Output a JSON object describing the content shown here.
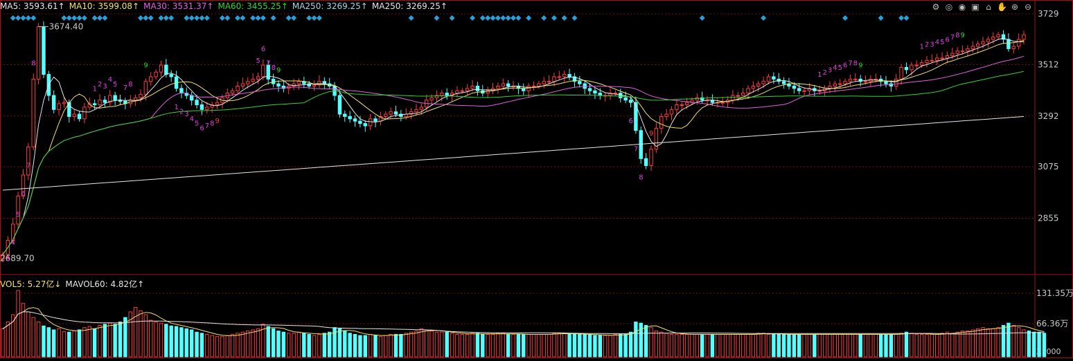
{
  "legend_main": [
    {
      "label": "MA5: 3593.61",
      "arrow": "↑",
      "color": "#e6e6e6"
    },
    {
      "label": "MA10: 3599.08",
      "arrow": "↑",
      "color": "#f2e26b"
    },
    {
      "label": "MA30: 3531.37",
      "arrow": "↑",
      "color": "#e25fe2"
    },
    {
      "label": "MA60: 3455.25",
      "arrow": "↑",
      "color": "#33d633"
    },
    {
      "label": "MA250: 3269.25",
      "arrow": "↑",
      "color": "#9ed8e8"
    },
    {
      "label": "MA250: 3269.25",
      "arrow": "↑",
      "color": "#e6e6e6"
    }
  ],
  "legend_volume": [
    {
      "label": "VOL5: 5.27亿",
      "arrow": "↓",
      "color": "#f2e26b"
    },
    {
      "label": "MAVOL60: 4.82亿",
      "arrow": "↑",
      "color": "#e6e6e6"
    }
  ],
  "toolbar_icons": [
    "settings-icon",
    "view-icon",
    "eye-icon",
    "bag-icon",
    "lock-icon",
    "hand-icon",
    "zoom-in-icon",
    "zoom-out-icon"
  ],
  "chart_data": {
    "type": "candlestick",
    "price_axis": {
      "ticks": [
        "3729",
        "3512",
        "3292",
        "3075",
        "2855"
      ],
      "ylim": [
        2620,
        3729
      ]
    },
    "volume_axis": {
      "ticks": [
        "131.35万",
        "66.36万"
      ],
      "unit_label": "X1000"
    },
    "annotations": {
      "high": "3674.40",
      "low": "2689.70"
    },
    "colors": {
      "up": "#ff3c3c",
      "down": "#54ffff",
      "ma5": "#e6e6e6",
      "ma10": "#f2e26b",
      "ma30": "#e25fe2",
      "ma60": "#33d633",
      "ma250": "#e6e6e6",
      "seq": "#e040e0",
      "nine": "#22dd22",
      "nine_low": "#ff4040",
      "diamond": "#2aa0d8",
      "grid": "#7a1010",
      "frame": "#a01010"
    },
    "closes": [
      2700,
      2760,
      2830,
      2950,
      3040,
      3160,
      3450,
      3674,
      3470,
      3380,
      3320,
      3345,
      3350,
      3290,
      3300,
      3280,
      3330,
      3345,
      3340,
      3360,
      3350,
      3380,
      3360,
      3355,
      3345,
      3360,
      3370,
      3385,
      3440,
      3460,
      3480,
      3510,
      3470,
      3460,
      3410,
      3390,
      3380,
      3360,
      3340,
      3320,
      3330,
      3340,
      3350,
      3370,
      3390,
      3400,
      3420,
      3430,
      3440,
      3450,
      3460,
      3510,
      3450,
      3430,
      3420,
      3410,
      3420,
      3430,
      3440,
      3430,
      3420,
      3425,
      3440,
      3430,
      3420,
      3380,
      3300,
      3290,
      3280,
      3270,
      3260,
      3250,
      3280,
      3270,
      3290,
      3300,
      3310,
      3300,
      3290,
      3300,
      3310,
      3320,
      3330,
      3360,
      3370,
      3380,
      3390,
      3380,
      3390,
      3400,
      3400,
      3410,
      3420,
      3400,
      3390,
      3400,
      3410,
      3420,
      3430,
      3420,
      3420,
      3410,
      3400,
      3420,
      3420,
      3430,
      3440,
      3440,
      3460,
      3460,
      3470,
      3460,
      3440,
      3430,
      3410,
      3400,
      3390,
      3380,
      3380,
      3390,
      3390,
      3370,
      3360,
      3350,
      3230,
      3110,
      3080,
      3150,
      3240,
      3290,
      3300,
      3320,
      3340,
      3340,
      3350,
      3360,
      3370,
      3360,
      3360,
      3350,
      3350,
      3350,
      3360,
      3380,
      3380,
      3390,
      3410,
      3420,
      3430,
      3440,
      3460,
      3450,
      3440,
      3430,
      3420,
      3410,
      3400,
      3400,
      3410,
      3400,
      3400,
      3410,
      3420,
      3430,
      3430,
      3440,
      3450,
      3450,
      3440,
      3440,
      3450,
      3450,
      3440,
      3430,
      3420,
      3450,
      3500,
      3490,
      3510,
      3510,
      3520,
      3530,
      3530,
      3540,
      3540,
      3550,
      3560,
      3570,
      3570,
      3580,
      3590,
      3600,
      3610,
      3620,
      3630,
      3640,
      3620,
      3580,
      3590,
      3620,
      3640
    ],
    "volumes": [
      50,
      62,
      75,
      118,
      95,
      80,
      70,
      62,
      55,
      52,
      48,
      50,
      45,
      44,
      46,
      48,
      52,
      54,
      50,
      56,
      58,
      60,
      58,
      62,
      70,
      80,
      88,
      82,
      75,
      65,
      62,
      60,
      58,
      55,
      54,
      52,
      50,
      48,
      44,
      42,
      40,
      38,
      36,
      36,
      38,
      40,
      42,
      44,
      46,
      48,
      50,
      58,
      54,
      50,
      46,
      44,
      42,
      42,
      44,
      42,
      40,
      38,
      40,
      42,
      44,
      52,
      50,
      46,
      42,
      40,
      38,
      38,
      40,
      38,
      36,
      38,
      40,
      40,
      40,
      42,
      44,
      46,
      50,
      48,
      46,
      44,
      44,
      44,
      42,
      40,
      40,
      40,
      42,
      42,
      40,
      40,
      40,
      42,
      42,
      40,
      40,
      40,
      40,
      40,
      40,
      40,
      40,
      40,
      42,
      42,
      42,
      40,
      40,
      40,
      40,
      40,
      38,
      38,
      38,
      38,
      40,
      40,
      40,
      44,
      62,
      60,
      56,
      52,
      46,
      44,
      42,
      40,
      40,
      40,
      40,
      40,
      40,
      40,
      40,
      40,
      40,
      40,
      40,
      40,
      40,
      40,
      40,
      40,
      42,
      42,
      40,
      40,
      40,
      40,
      40,
      40,
      40,
      40,
      40,
      40,
      40,
      40,
      40,
      40,
      40,
      40,
      40,
      40,
      40,
      40,
      40,
      40,
      40,
      40,
      40,
      40,
      42,
      44,
      42,
      40,
      40,
      40,
      40,
      40,
      42,
      44,
      42,
      44,
      46,
      46,
      48,
      50,
      52,
      50,
      50,
      52,
      56,
      60,
      56,
      52,
      48,
      46,
      44,
      44,
      42
    ]
  }
}
